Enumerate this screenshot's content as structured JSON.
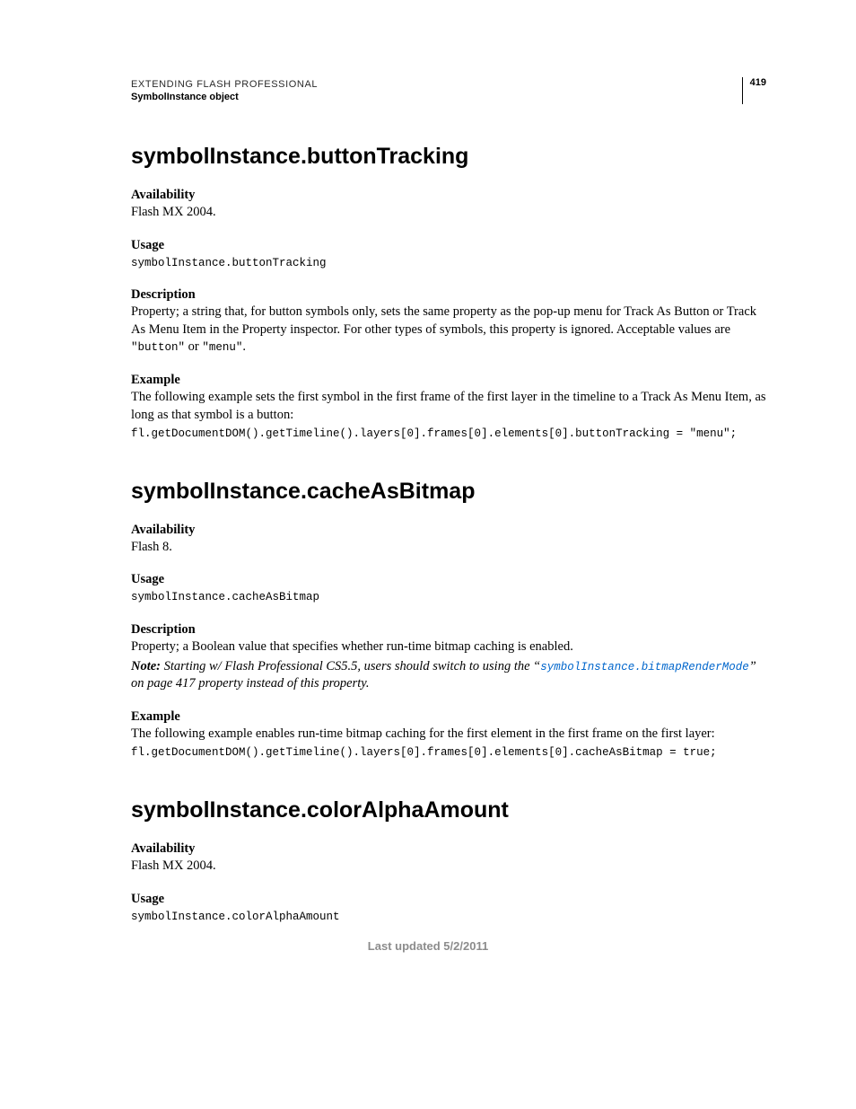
{
  "header": {
    "doc_title": "EXTENDING FLASH PROFESSIONAL",
    "section_name": "SymbolInstance object",
    "page_number": "419"
  },
  "sections": [
    {
      "heading": "symbolInstance.buttonTracking",
      "availability_label": "Availability",
      "availability_text": "Flash MX 2004.",
      "usage_label": "Usage",
      "usage_code": "symbolInstance.buttonTracking",
      "description_label": "Description",
      "description_text_1": "Property; a string that, for button symbols only, sets the same property as the pop-up menu for Track As Button or Track As Menu Item in the Property inspector. For other types of symbols, this property is ignored. Acceptable values are ",
      "description_code_1": "\"button\"",
      "description_text_1b": " or ",
      "description_code_2": "\"menu\"",
      "description_text_1c": ".",
      "example_label": "Example",
      "example_text": "The following example sets the first symbol in the first frame of the first layer in the timeline to a Track As Menu Item, as long as that symbol is a button:",
      "example_code": "fl.getDocumentDOM().getTimeline().layers[0].frames[0].elements[0].buttonTracking = \"menu\";"
    },
    {
      "heading": "symbolInstance.cacheAsBitmap",
      "availability_label": "Availability",
      "availability_text": "Flash 8.",
      "usage_label": "Usage",
      "usage_code": "symbolInstance.cacheAsBitmap",
      "description_label": "Description",
      "description_text": "Property; a Boolean value that specifies whether run-time bitmap caching is enabled.",
      "note_prefix": "Note:",
      "note_text_a": " Starting w/ Flash Professional CS5.5, users should switch to using the “",
      "note_link": "symbolInstance.bitmapRenderMode",
      "note_text_b": "” on page 417 property instead of this property.",
      "example_label": "Example",
      "example_text": "The following example enables run-time bitmap caching for the first element in the first frame on the first layer:",
      "example_code": "fl.getDocumentDOM().getTimeline().layers[0].frames[0].elements[0].cacheAsBitmap = true;"
    },
    {
      "heading": "symbolInstance.colorAlphaAmount",
      "availability_label": "Availability",
      "availability_text": "Flash MX 2004.",
      "usage_label": "Usage",
      "usage_code": "symbolInstance.colorAlphaAmount"
    }
  ],
  "footer": "Last updated 5/2/2011"
}
